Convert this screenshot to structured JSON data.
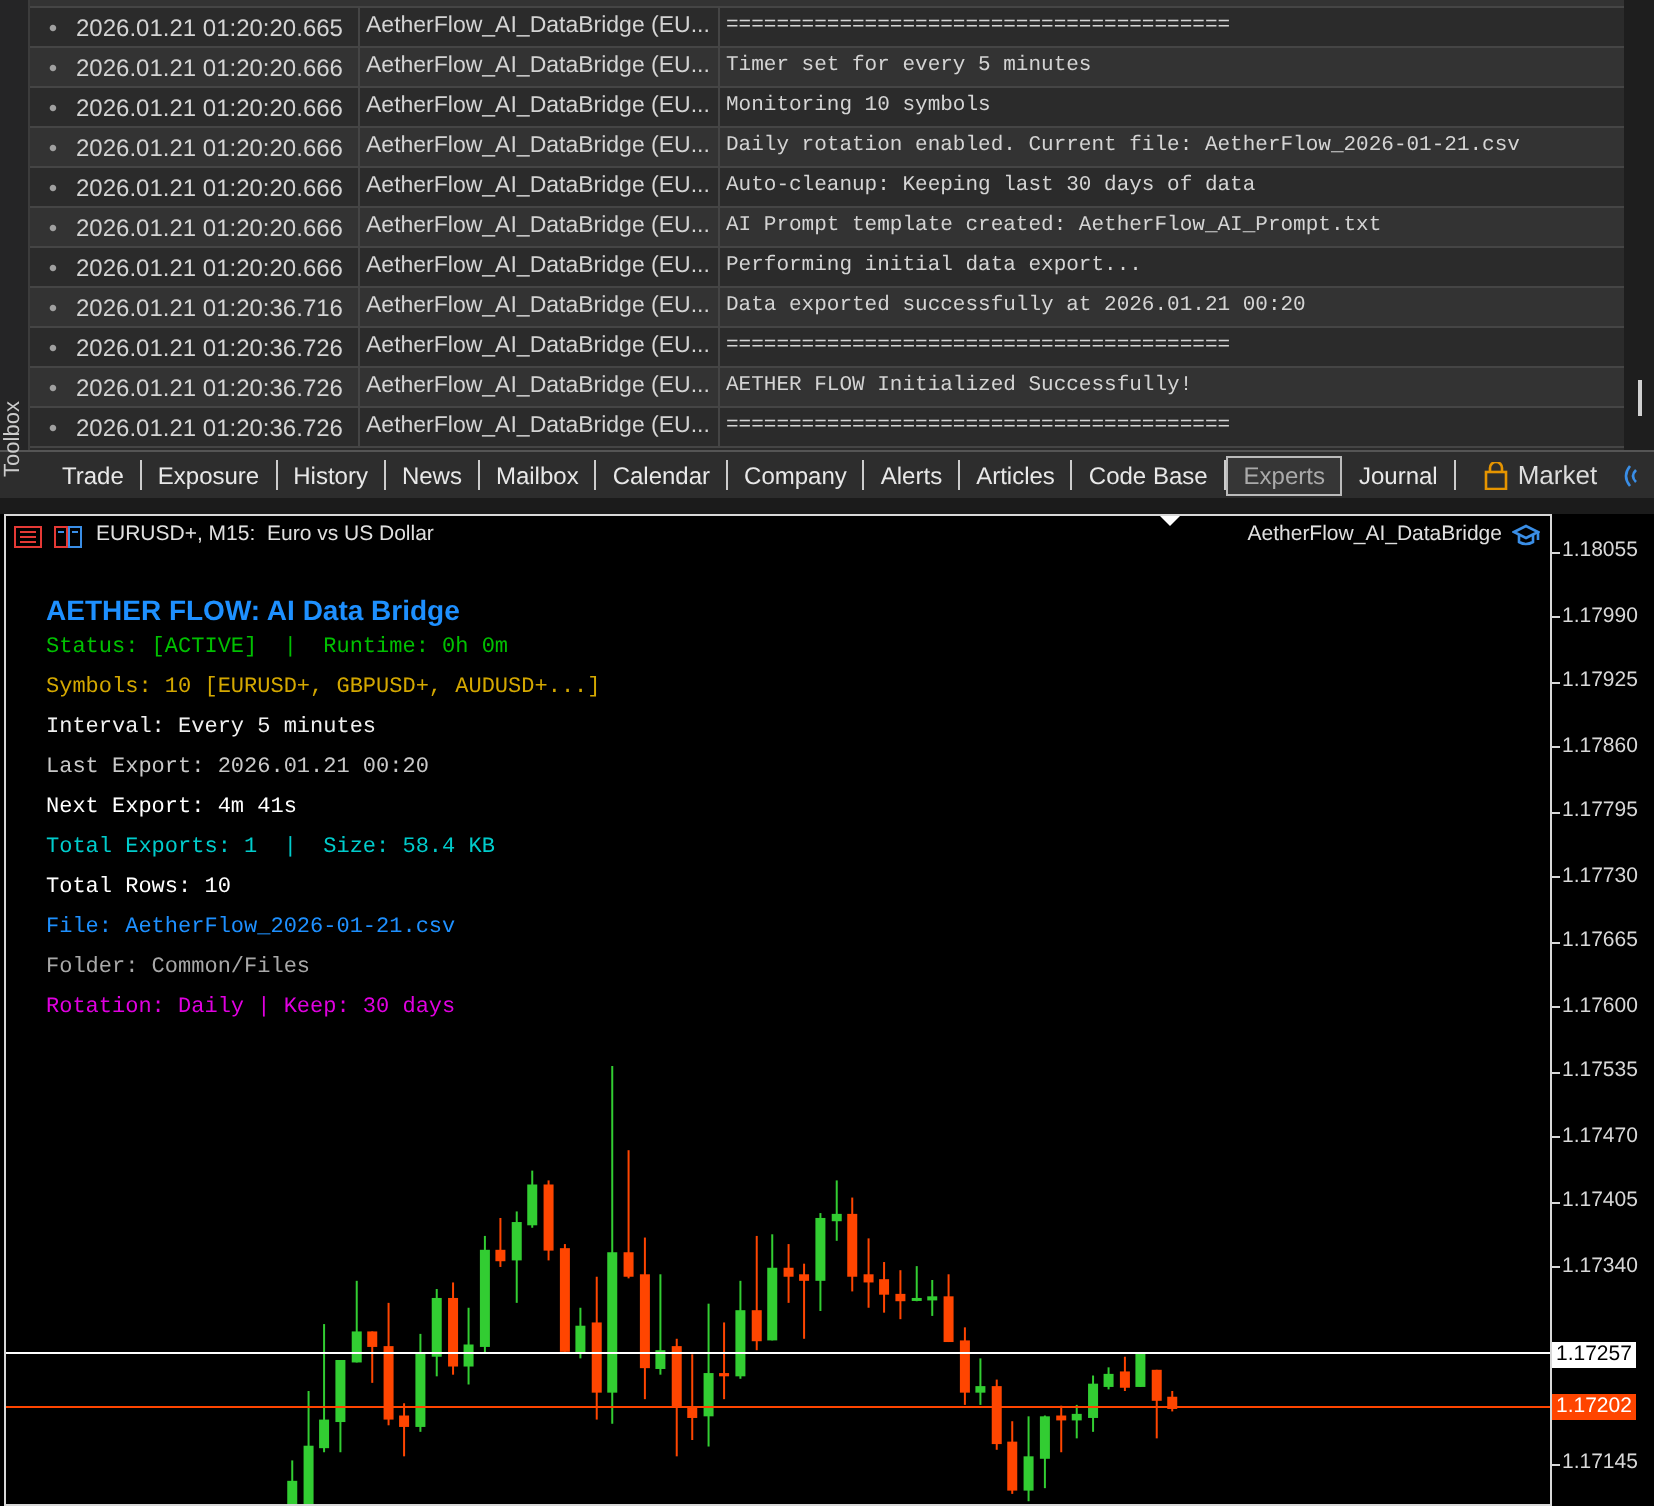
{
  "toolbox": {
    "label": "Toolbox"
  },
  "journal": {
    "rows": [
      {
        "time": "2026.01.21 01:20:20.665",
        "source": "AetherFlow_AI_DataBridge (EU...",
        "message": "========================================"
      },
      {
        "time": "2026.01.21 01:20:20.666",
        "source": "AetherFlow_AI_DataBridge (EU...",
        "message": "Timer set for every 5 minutes"
      },
      {
        "time": "2026.01.21 01:20:20.666",
        "source": "AetherFlow_AI_DataBridge (EU...",
        "message": "Monitoring 10 symbols"
      },
      {
        "time": "2026.01.21 01:20:20.666",
        "source": "AetherFlow_AI_DataBridge (EU...",
        "message": "Daily rotation enabled. Current file: AetherFlow_2026-01-21.csv"
      },
      {
        "time": "2026.01.21 01:20:20.666",
        "source": "AetherFlow_AI_DataBridge (EU...",
        "message": "Auto-cleanup: Keeping last 30 days of data"
      },
      {
        "time": "2026.01.21 01:20:20.666",
        "source": "AetherFlow_AI_DataBridge (EU...",
        "message": "AI Prompt template created: AetherFlow_AI_Prompt.txt"
      },
      {
        "time": "2026.01.21 01:20:20.666",
        "source": "AetherFlow_AI_DataBridge (EU...",
        "message": "Performing initial data export..."
      },
      {
        "time": "2026.01.21 01:20:36.716",
        "source": "AetherFlow_AI_DataBridge (EU...",
        "message": "Data exported successfully at 2026.01.21 00:20"
      },
      {
        "time": "2026.01.21 01:20:36.726",
        "source": "AetherFlow_AI_DataBridge (EU...",
        "message": "========================================"
      },
      {
        "time": "2026.01.21 01:20:36.726",
        "source": "AetherFlow_AI_DataBridge (EU...",
        "message": "AETHER FLOW Initialized Successfully!"
      },
      {
        "time": "2026.01.21 01:20:36.726",
        "source": "AetherFlow_AI_DataBridge (EU...",
        "message": "========================================"
      }
    ],
    "bullet": "•"
  },
  "tabs": [
    {
      "label": "Trade",
      "selected": false
    },
    {
      "label": "Exposure",
      "selected": false
    },
    {
      "label": "History",
      "selected": false
    },
    {
      "label": "News",
      "selected": false
    },
    {
      "label": "Mailbox",
      "selected": false
    },
    {
      "label": "Calendar",
      "selected": false
    },
    {
      "label": "Company",
      "selected": false
    },
    {
      "label": "Alerts",
      "selected": false
    },
    {
      "label": "Articles",
      "selected": false
    },
    {
      "label": "Code Base",
      "selected": false
    },
    {
      "label": "Experts",
      "selected": true
    },
    {
      "label": "Journal",
      "selected": false
    }
  ],
  "market_tab": {
    "label": "Market"
  },
  "chart": {
    "symbol": "EURUSD+, M15:  Euro vs US Dollar",
    "expert": "AetherFlow_AI_DataBridge",
    "panel": {
      "title": "AETHER FLOW: AI Data Bridge",
      "lines": [
        {
          "text": "Status: [ACTIVE]  |  Runtime: 0h 0m",
          "color": "#00c000"
        },
        {
          "text": "Symbols: 10 [EURUSD+, GBPUSD+, AUDUSD+...]",
          "color": "#d4a800"
        },
        {
          "text": "Interval: Every 5 minutes",
          "color": "#f0f0f0"
        },
        {
          "text": "Last Export: 2026.01.21 00:20",
          "color": "#c8c8c8"
        },
        {
          "text": "Next Export: 4m 41s",
          "color": "#ffffff"
        },
        {
          "text": "Total Exports: 1  |  Size: 58.4 KB",
          "color": "#00cccc"
        },
        {
          "text": "Total Rows: 10",
          "color": "#ffffff"
        },
        {
          "text": "File: AetherFlow_2026-01-21.csv",
          "color": "#1e90ff"
        },
        {
          "text": "Folder: Common/Files",
          "color": "#a8a8a8"
        },
        {
          "text": "Rotation: Daily | Keep: 30 days",
          "color": "#e000e0"
        }
      ]
    },
    "price_ticks": [
      "1.18055",
      "1.17990",
      "1.17925",
      "1.17860",
      "1.17795",
      "1.17730",
      "1.17665",
      "1.17600",
      "1.17535",
      "1.17470",
      "1.17405",
      "1.17340"
    ],
    "bottom_tick": "1.17145",
    "ask_label": "1.17257",
    "bid_label": "1.17202"
  }
}
